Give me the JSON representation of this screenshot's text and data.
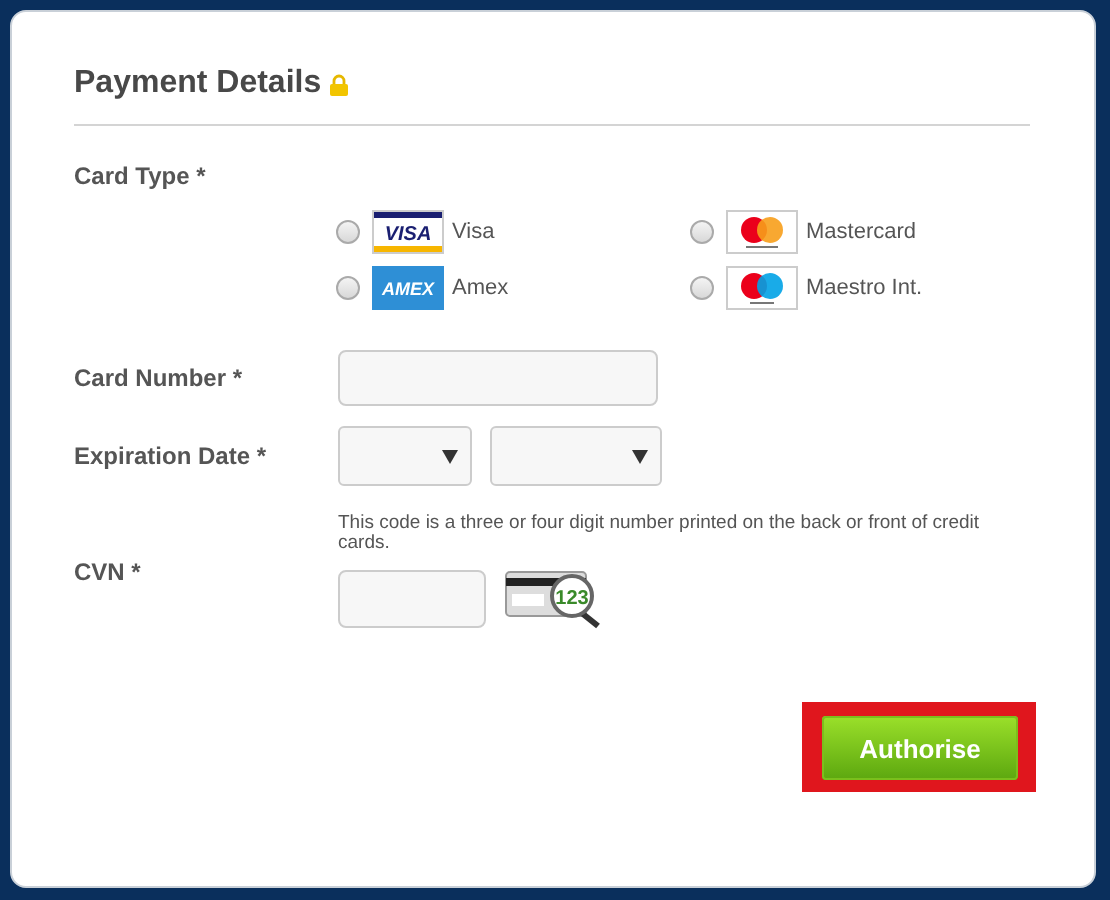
{
  "heading": {
    "title": "Payment Details",
    "secure": true
  },
  "card_type": {
    "label": "Card Type *",
    "options": [
      {
        "label": "Visa",
        "kind": "visa",
        "logo_text": "VISA",
        "selected": false
      },
      {
        "label": "Mastercard",
        "kind": "mastercard",
        "selected": false
      },
      {
        "label": "Amex",
        "kind": "amex",
        "logo_text": "AMEX",
        "selected": false
      },
      {
        "label": "Maestro Int.",
        "kind": "maestro",
        "selected": false
      }
    ]
  },
  "card_number": {
    "label": "Card Number *"
  },
  "expiration": {
    "label": "Expiration Date *",
    "selects": [
      {
        "kind": "month"
      },
      {
        "kind": "year"
      }
    ]
  },
  "cvn": {
    "label": "CVN *",
    "hint": "This code is a three or four digit number printed on the back or front of credit cards.",
    "icon_text": "123"
  },
  "submit": {
    "label": "Authorise",
    "highlighted": true
  }
}
